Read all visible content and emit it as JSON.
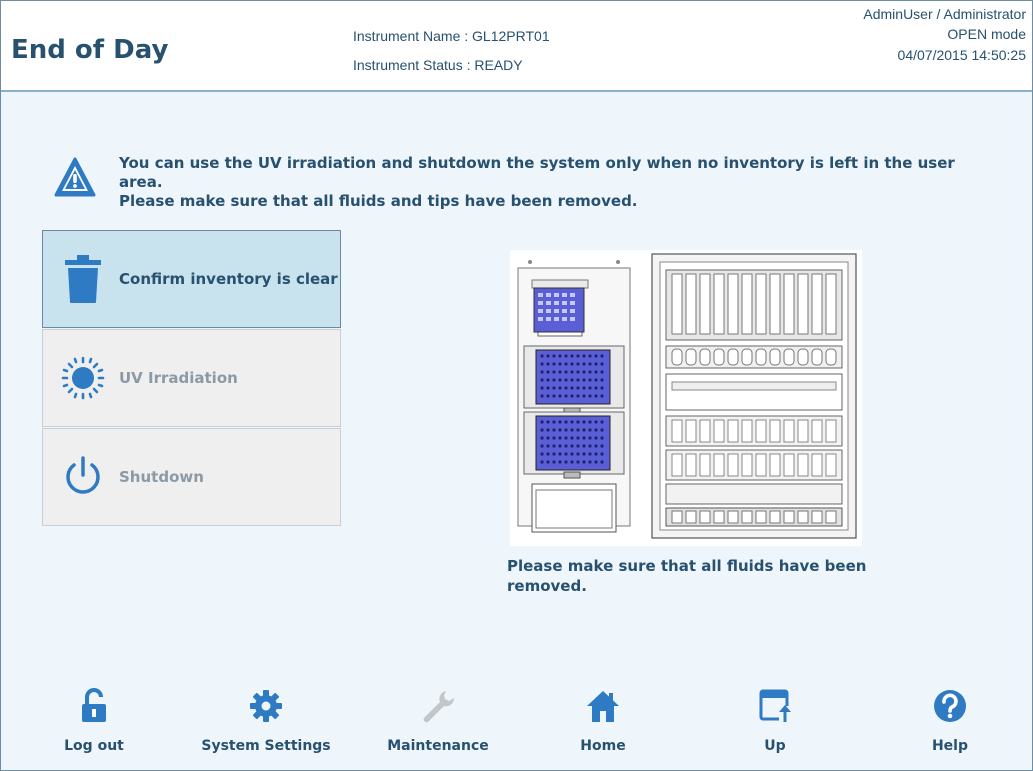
{
  "header": {
    "title": "End of Day",
    "instrument_name": "Instrument Name : GL12PRT01",
    "instrument_status": "Instrument Status : READY",
    "user": "AdminUser / Administrator",
    "mode": "OPEN mode",
    "datetime": "04/07/2015 14:50:25"
  },
  "warning": {
    "line1": "You can use the UV irradiation and shutdown the system only when no inventory is left in the user area.",
    "line2": "Please make sure that all fluids and tips have been removed."
  },
  "actions": [
    {
      "label": "Confirm inventory is clear",
      "icon": "trash-icon",
      "state": "active"
    },
    {
      "label": "UV Irradiation",
      "icon": "sun-icon",
      "state": "disabled"
    },
    {
      "label": "Shutdown",
      "icon": "power-icon",
      "state": "disabled"
    }
  ],
  "diagram": {
    "note": "Please make sure that all fluids have been removed."
  },
  "footer": [
    {
      "label": "Log out",
      "icon": "unlock-icon"
    },
    {
      "label": "System Settings",
      "icon": "gear-icon"
    },
    {
      "label": "Maintenance",
      "icon": "wrench-icon",
      "state": "disabled"
    },
    {
      "label": "Home",
      "icon": "home-icon"
    },
    {
      "label": "Up",
      "icon": "up-window-icon"
    },
    {
      "label": "Help",
      "icon": "help-icon"
    }
  ],
  "colors": {
    "accent": "#27516f",
    "icon_blue": "#2f7bc3",
    "active_button": "#c9e3ee",
    "tray_purple": "#5b5fd6"
  }
}
